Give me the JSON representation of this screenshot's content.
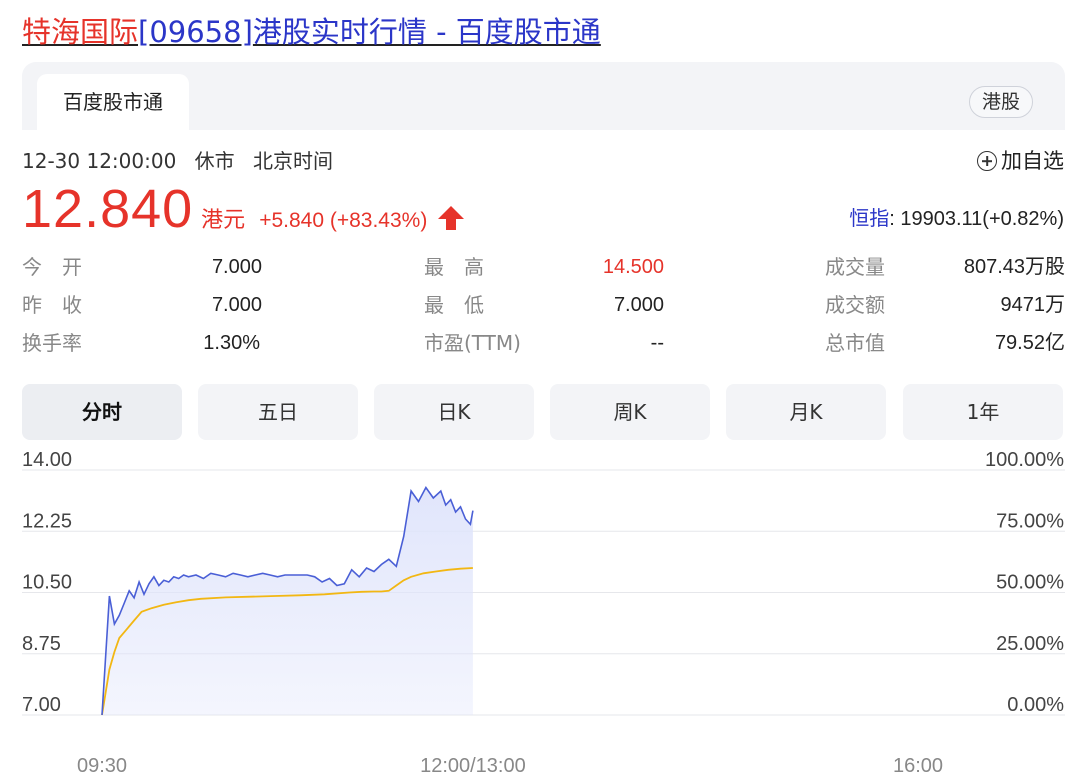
{
  "page_title": {
    "name": "特海国际",
    "code": "[09658]",
    "rest": "港股实时行情 - 百度股市通"
  },
  "header": {
    "tab_label": "百度股市通",
    "market_badge": "港股"
  },
  "status": {
    "datetime": "12-30 12:00:00",
    "market_state": "休市",
    "timezone": "北京时间"
  },
  "watchlist": {
    "label": "加自选",
    "icon": "plus-circle-icon"
  },
  "quote": {
    "price": "12.840",
    "currency": "港元",
    "change": "+5.840 (+83.43%)",
    "direction_icon": "up-arrow-icon"
  },
  "index_quote": {
    "name": "恒指",
    "value": ": 19903.11(+0.82%)"
  },
  "stats": [
    {
      "label": "今　开",
      "value": "7.000"
    },
    {
      "label": "昨　收",
      "value": "7.000"
    },
    {
      "label": "换手率",
      "value": "1.30%"
    },
    {
      "label": "最　高",
      "value": "14.500"
    },
    {
      "label": "最　低",
      "value": "7.000"
    },
    {
      "label": "市盈(TTM)",
      "value": "--"
    },
    {
      "label": "成交量",
      "value": "807.43万股"
    },
    {
      "label": "成交额",
      "value": "9471万"
    },
    {
      "label": "总市值",
      "value": "79.52亿"
    }
  ],
  "periods": [
    "分时",
    "五日",
    "日K",
    "周K",
    "月K",
    "1年"
  ],
  "active_period": "分时",
  "colors": {
    "up": "#e6332a",
    "link": "#2b36c8",
    "price_line": "#4a5fd6",
    "avg_line": "#f2b713",
    "area_fill": "#dfe4fb",
    "grid": "#e6e7eb"
  },
  "chart_data": {
    "type": "line",
    "ylim": [
      7.0,
      14.0
    ],
    "left_ticks": [
      "14.00",
      "12.25",
      "10.50",
      "8.75",
      "7.00"
    ],
    "right_ticks": [
      "100.00%",
      "75.00%",
      "50.00%",
      "25.00%",
      "0.00%"
    ],
    "x_ticks": [
      "09:30",
      "12:00/13:00",
      "16:00"
    ],
    "x_minutes": [
      0,
      150,
      330
    ],
    "series": [
      {
        "role": "price",
        "x": [
          0,
          3,
          5,
          7,
          9,
          11,
          13,
          15,
          17,
          19,
          21,
          23,
          25,
          27,
          29,
          31,
          33,
          35,
          38,
          41,
          44,
          47,
          50,
          53,
          56,
          59,
          62,
          65,
          68,
          71,
          74,
          77,
          80,
          83,
          86,
          89,
          92,
          95,
          98,
          101,
          104,
          107,
          110,
          113,
          116,
          119,
          122,
          125,
          128,
          131,
          134,
          137,
          139,
          141,
          143,
          145,
          147,
          149,
          150
        ],
        "y": [
          7.0,
          10.4,
          9.6,
          9.85,
          10.2,
          10.55,
          10.35,
          10.8,
          10.45,
          10.75,
          10.95,
          10.7,
          10.85,
          10.8,
          10.95,
          10.9,
          11.0,
          10.95,
          11.0,
          10.9,
          11.05,
          11.0,
          10.95,
          11.05,
          11.0,
          10.95,
          11.0,
          11.05,
          11.0,
          10.95,
          11.0,
          11.0,
          11.0,
          11.0,
          10.95,
          10.8,
          10.9,
          10.7,
          10.75,
          11.15,
          10.95,
          11.2,
          11.1,
          11.3,
          11.45,
          11.25,
          12.1,
          13.4,
          13.1,
          13.5,
          13.2,
          13.4,
          13.0,
          13.15,
          12.8,
          12.95,
          12.6,
          12.45,
          12.84
        ]
      },
      {
        "role": "average",
        "x": [
          0,
          3,
          5,
          7,
          10,
          13,
          16,
          20,
          25,
          30,
          35,
          40,
          50,
          60,
          70,
          80,
          90,
          100,
          105,
          110,
          113,
          116,
          119,
          122,
          125,
          130,
          135,
          140,
          145,
          150
        ],
        "y": [
          7.0,
          8.3,
          8.8,
          9.2,
          9.45,
          9.7,
          9.95,
          10.05,
          10.15,
          10.22,
          10.28,
          10.32,
          10.36,
          10.38,
          10.4,
          10.42,
          10.45,
          10.5,
          10.52,
          10.53,
          10.53,
          10.55,
          10.7,
          10.85,
          10.95,
          11.05,
          11.1,
          11.15,
          11.18,
          11.2
        ]
      }
    ]
  }
}
